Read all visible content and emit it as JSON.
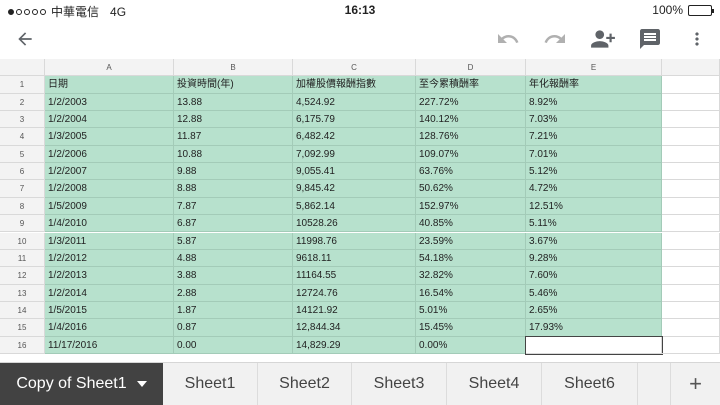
{
  "status_bar": {
    "carrier": "中華電信",
    "network": "4G",
    "time": "16:13",
    "battery": "100%",
    "signal_bars_filled": 1,
    "signal_bars_total": 5
  },
  "toolbar": {
    "back_icon": "arrow-left-icon",
    "undo_icon": "undo-icon",
    "redo_icon": "redo-icon",
    "share_icon": "add-person-icon",
    "comment_icon": "comment-icon",
    "more_icon": "more-vert-icon"
  },
  "colors": {
    "highlight": "#b7e1cd",
    "active_tab": "#424242",
    "toolbar_icon": "#5f6368"
  },
  "sheet": {
    "columns": [
      "A",
      "B",
      "C",
      "D",
      "E"
    ],
    "rows": [
      {
        "num": "1",
        "cells": [
          "日期",
          "投資時間(年)",
          "加權股價報酬指數",
          "至今累積酬率",
          "年化報酬率"
        ]
      },
      {
        "num": "2",
        "cells": [
          "1/2/2003",
          "13.88",
          "4,524.92",
          "227.72%",
          "8.92%"
        ]
      },
      {
        "num": "3",
        "cells": [
          "1/2/2004",
          "12.88",
          "6,175.79",
          "140.12%",
          "7.03%"
        ]
      },
      {
        "num": "4",
        "cells": [
          "1/3/2005",
          "11.87",
          "6,482.42",
          "128.76%",
          "7.21%"
        ]
      },
      {
        "num": "5",
        "cells": [
          "1/2/2006",
          "10.88",
          "7,092.99",
          "109.07%",
          "7.01%"
        ]
      },
      {
        "num": "6",
        "cells": [
          "1/2/2007",
          "9.88",
          "9,055.41",
          "63.76%",
          "5.12%"
        ]
      },
      {
        "num": "7",
        "cells": [
          "1/2/2008",
          "8.88",
          "9,845.42",
          "50.62%",
          "4.72%"
        ]
      },
      {
        "num": "8",
        "cells": [
          "1/5/2009",
          "7.87",
          "5,862.14",
          "152.97%",
          "12.51%"
        ]
      },
      {
        "num": "9",
        "cells": [
          "1/4/2010",
          "6.87",
          "10528.26",
          "40.85%",
          "5.11%"
        ]
      },
      {
        "num": "10",
        "cells": [
          "1/3/2011",
          "5.87",
          "11998.76",
          "23.59%",
          "3.67%"
        ]
      },
      {
        "num": "11",
        "cells": [
          "1/2/2012",
          "4.88",
          "9618.11",
          "54.18%",
          "9.28%"
        ]
      },
      {
        "num": "12",
        "cells": [
          "1/2/2013",
          "3.88",
          "11164.55",
          "32.82%",
          "7.60%"
        ]
      },
      {
        "num": "13",
        "cells": [
          "1/2/2014",
          "2.88",
          "12724.76",
          "16.54%",
          "5.46%"
        ]
      },
      {
        "num": "14",
        "cells": [
          "1/5/2015",
          "1.87",
          "14121.92",
          "5.01%",
          "2.65%"
        ]
      },
      {
        "num": "15",
        "cells": [
          "1/4/2016",
          "0.87",
          "12,844.34",
          "15.45%",
          "17.93%"
        ]
      },
      {
        "num": "16",
        "cells": [
          "11/17/2016",
          "0.00",
          "14,829.29",
          "0.00%",
          ""
        ]
      }
    ]
  },
  "tabs": [
    {
      "label": "Copy of Sheet1",
      "active": true
    },
    {
      "label": "Sheet1",
      "active": false
    },
    {
      "label": "Sheet2",
      "active": false
    },
    {
      "label": "Sheet3",
      "active": false
    },
    {
      "label": "Sheet4",
      "active": false
    },
    {
      "label": "Sheet6",
      "active": false
    }
  ],
  "add_sheet_label": "+"
}
